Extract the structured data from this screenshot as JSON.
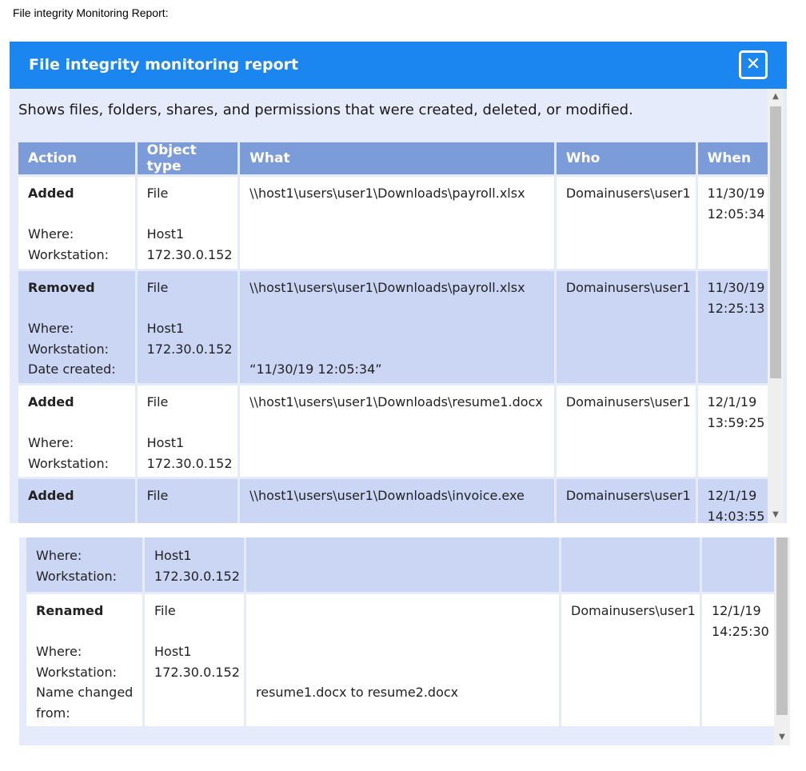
{
  "page_caption": "File integrity Monitoring Report:",
  "dialog": {
    "title": "File integrity monitoring report",
    "close_glyph": "✕",
    "description": "Shows files, folders, shares, and permissions that were created, deleted, or modified."
  },
  "table": {
    "headers": [
      "Action",
      "Object type",
      "What",
      "Who",
      "When"
    ],
    "rows": [
      {
        "action": "Added",
        "labels": [
          "Where:",
          "Workstation:"
        ],
        "object_type": "File",
        "values": [
          "Host1",
          "172.30.0.152"
        ],
        "what": "\\\\host1\\users\\user1\\Downloads\\payroll.xlsx",
        "who": "Domainusers\\user1",
        "when_date": "11/30/19",
        "when_time": "12:05:34"
      },
      {
        "action": "Removed",
        "labels": [
          "Where:",
          "Workstation:",
          "Date created:"
        ],
        "object_type": "File",
        "values": [
          "Host1",
          "172.30.0.152"
        ],
        "what": "\\\\host1\\users\\user1\\Downloads\\payroll.xlsx",
        "what_extra": "“11/30/19 12:05:34”",
        "who": "Domainusers\\user1",
        "when_date": "11/30/19",
        "when_time": "12:25:13"
      },
      {
        "action": "Added",
        "labels": [
          "Where:",
          "Workstation:"
        ],
        "object_type": "File",
        "values": [
          "Host1",
          "172.30.0.152"
        ],
        "what": "\\\\host1\\users\\user1\\Downloads\\resume1.docx",
        "who": "Domainusers\\user1",
        "when_date": "12/1/19",
        "when_time": "13:59:25"
      },
      {
        "action": "Added",
        "labels": [
          "Where:",
          "Workstation:"
        ],
        "object_type": "File",
        "values": [
          "Host1",
          "172.30.0.152"
        ],
        "what": "\\\\host1\\users\\user1\\Downloads\\invoice.exe",
        "who": "Domainusers\\user1",
        "when_date": "12/1/19",
        "when_time": "14:03:55"
      },
      {
        "action": "Renamed",
        "labels": [
          "Where:",
          "Workstation:",
          "Name changed",
          "from:"
        ],
        "object_type": "File",
        "values": [
          "Host1",
          "172.30.0.152"
        ],
        "what_extra": "resume1.docx to resume2.docx",
        "who": "Domainusers\\user1",
        "when_date": "12/1/19",
        "when_time": "14:25:30"
      }
    ]
  },
  "scrollbar": {
    "up_glyph": "▲",
    "down_glyph": "▼"
  }
}
